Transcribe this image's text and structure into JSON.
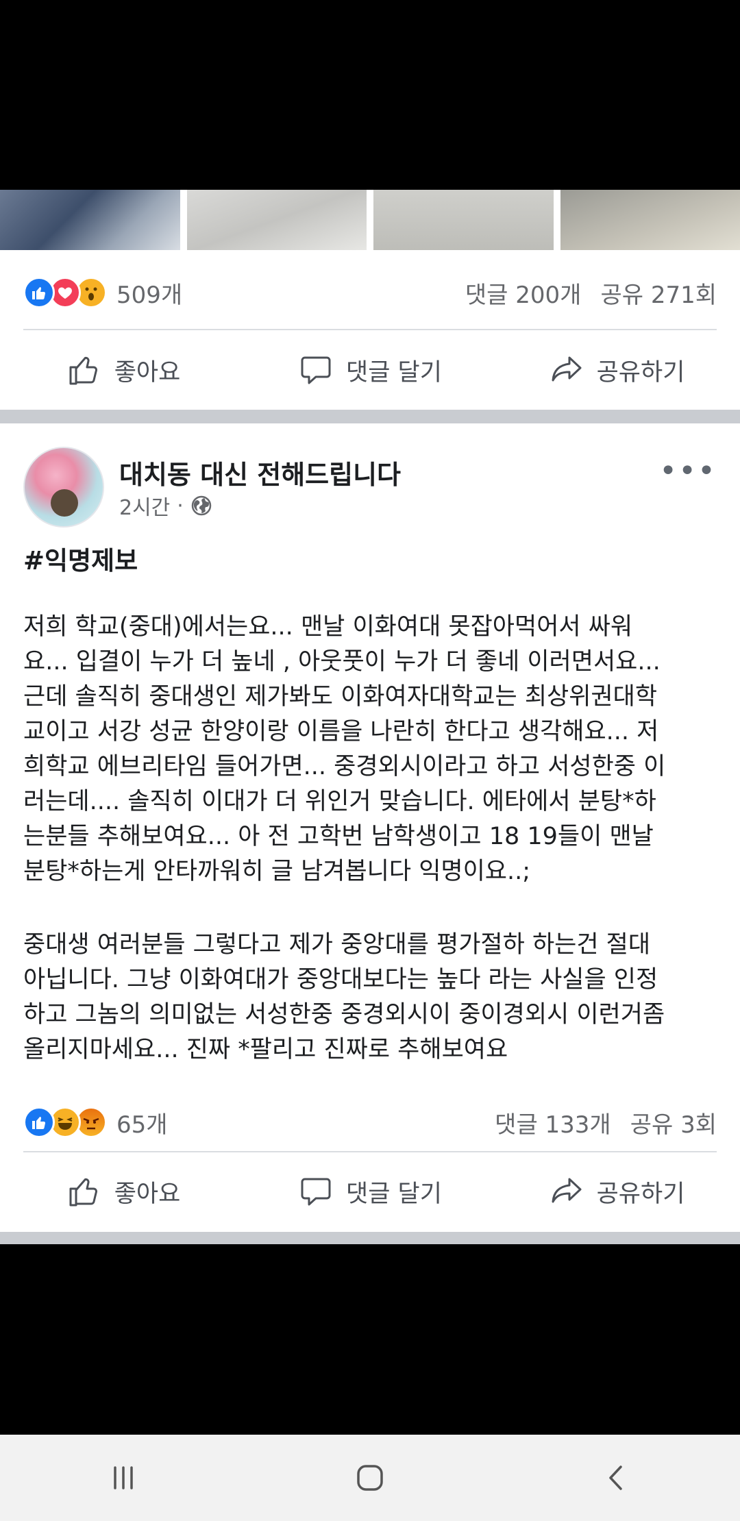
{
  "post1": {
    "reaction_count": "509개",
    "comments": "댓글 200개",
    "shares": "공유 271회"
  },
  "actions": {
    "like": "좋아요",
    "comment": "댓글 달기",
    "share": "공유하기"
  },
  "post2": {
    "page_name": "대치동 대신 전해드립니다",
    "time": "2시간",
    "separator": "·",
    "hashtag": "#익명제보",
    "paragraph1": "저희 학교(중대)에서는요... 맨날 이화여대 못잡아먹어서 싸워\n요... 입결이 누가 더 높네 , 아웃풋이 누가 더 좋네 이러면서요...\n근데 솔직히 중대생인 제가봐도 이화여자대학교는 최상위권대학\n교이고 서강 성균 한양이랑 이름을 나란히 한다고 생각해요... 저\n희학교 에브리타임 들어가면... 중경외시이라고 하고 서성한중 이\n러는데.... 솔직히 이대가 더 위인거 맞습니다. 에타에서 분탕*하\n는분들 추해보여요... 아 전 고학번 남학생이고 18 19들이 맨날\n분탕*하는게 안타까워히 글 남겨봅니다 익명이요..;",
    "paragraph2": "중대생 여러분들 그렇다고 제가 중앙대를 평가절하 하는건 절대\n아닙니다. 그냥 이화여대가 중앙대보다는 높다 라는 사실을 인정\n하고 그놈의 의미없는 서성한중 중경외시이 중이경외시 이런거좀\n올리지마세요... 진짜 *팔리고 진짜로 추해보여요",
    "reaction_count": "65개",
    "comments": "댓글 133개",
    "shares": "공유 3회"
  },
  "icons": {
    "like": "like-reaction-icon",
    "love": "love-reaction-icon",
    "wow": "wow-reaction-icon",
    "haha": "haha-reaction-icon",
    "angry": "angry-reaction-icon",
    "globe": "globe-icon",
    "more": "more-icon"
  },
  "colors": {
    "facebook_blue": "#1877f2",
    "text_secondary": "#65676b",
    "divider": "#dadde1",
    "feed_gap": "#c9ccd1"
  }
}
